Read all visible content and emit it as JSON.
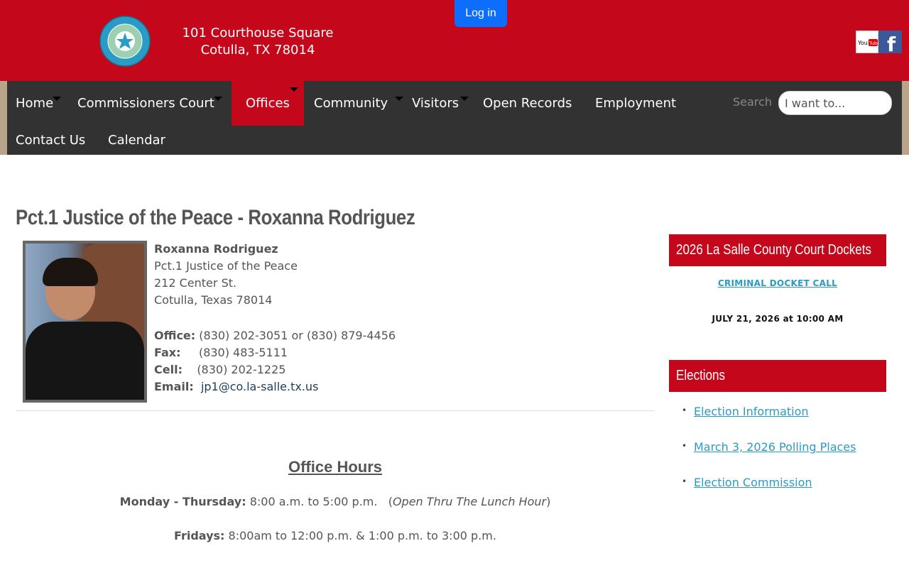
{
  "header": {
    "address_line1": "101 Courthouse Square",
    "address_line2": "Cotulla, TX 78014",
    "login_label": "Log in",
    "brand_color": "#c4071a",
    "seal_text": "THE STATE OF TEXAS · LA SALLE COUNTY",
    "youtube_label": "YouTube",
    "facebook_label": "f"
  },
  "nav": {
    "items": [
      {
        "label": "Home"
      },
      {
        "label": "Commissioners Court"
      },
      {
        "label": "Offices"
      },
      {
        "label": "Community"
      },
      {
        "label": "Visitors"
      },
      {
        "label": "Open Records"
      },
      {
        "label": "Employment"
      },
      {
        "label": "Contact Us"
      },
      {
        "label": "Calendar"
      }
    ],
    "search_label": "Search",
    "search_placeholder": "I want to..."
  },
  "main": {
    "title": "Pct.1 Justice of the Peace - Roxanna Rodriguez",
    "contact": {
      "name": "Roxanna Rodriguez",
      "position": "Pct.1 Justice of the Peace",
      "street": "212 Center St.",
      "city": "Cotulla, Texas 78014",
      "office_label": "Office:",
      "office_value": " (830) 202-3051 or (830) 879-4456",
      "fax_label": "Fax:",
      "fax_value": "     (830) 483-5111",
      "cell_label": "Cell:",
      "cell_value": "    (830) 202-1225",
      "email_label": "Email:",
      "email_value": "jp1@co.la-salle.tx.us"
    },
    "hours": {
      "title": "Office Hours",
      "mon_thu_label": "Monday - Thursday:",
      "mon_thu_value": " 8:00 a.m. to 5:00 p.m.   (",
      "mon_thu_note": "Open Thru The Lunch Hour",
      "mon_thu_close": ")",
      "fri_label": "Fridays:",
      "fri_value": " 8:00am to 12:00 p.m. & 1:00 p.m. to 3:00 p.m."
    }
  },
  "sidebar": {
    "dockets_title": "2026 La Salle County Court Dockets",
    "docket_link": "CRIMINAL DOCKET CALL",
    "docket_date": "JULY 21, 2026 at 10:00 AM",
    "elections_title": "Elections",
    "elections_links": [
      "Election Information",
      "March 3, 2026 Polling Places",
      "Election Commission"
    ]
  }
}
